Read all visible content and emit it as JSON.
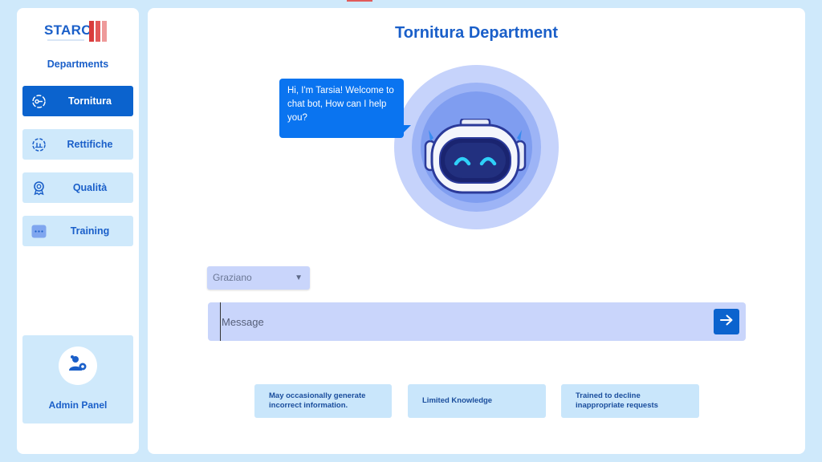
{
  "colors": {
    "background": "#cfe9fb",
    "accent": "#0b63ce",
    "brand_text": "#1a5fc9",
    "bubble": "#0a74f0",
    "logo_bars": [
      "#d93c3c",
      "#e35a5a",
      "#ee9a9a"
    ]
  },
  "sidebar": {
    "logo_text": "STARC",
    "section_title": "Departments",
    "items": [
      {
        "label": "Tornitura",
        "icon": "lathe-icon",
        "active": true
      },
      {
        "label": "Rettifiche",
        "icon": "grinding-icon",
        "active": false
      },
      {
        "label": "Qualità",
        "icon": "quality-badge-icon",
        "active": false
      },
      {
        "label": "Training",
        "icon": "more-dots-icon",
        "active": false
      }
    ],
    "admin": {
      "label": "Admin Panel",
      "icon": "admin-users-gear-icon"
    }
  },
  "main": {
    "title": "Tornitura Department",
    "bot": {
      "greeting": "Hi, I'm Tarsia! Welcome to chat bot, How can I help you?",
      "avatar_icon": "robot-avatar-icon"
    },
    "user_select": {
      "value": "Graziano",
      "caret_icon": "caret-down-icon"
    },
    "message": {
      "placeholder": "Message",
      "value": ""
    },
    "send": {
      "icon": "arrow-right-icon"
    },
    "disclaimers": [
      "May occasionally generate incorrect information.",
      "Limited Knowledge",
      "Trained to decline inappropriate requests"
    ]
  }
}
